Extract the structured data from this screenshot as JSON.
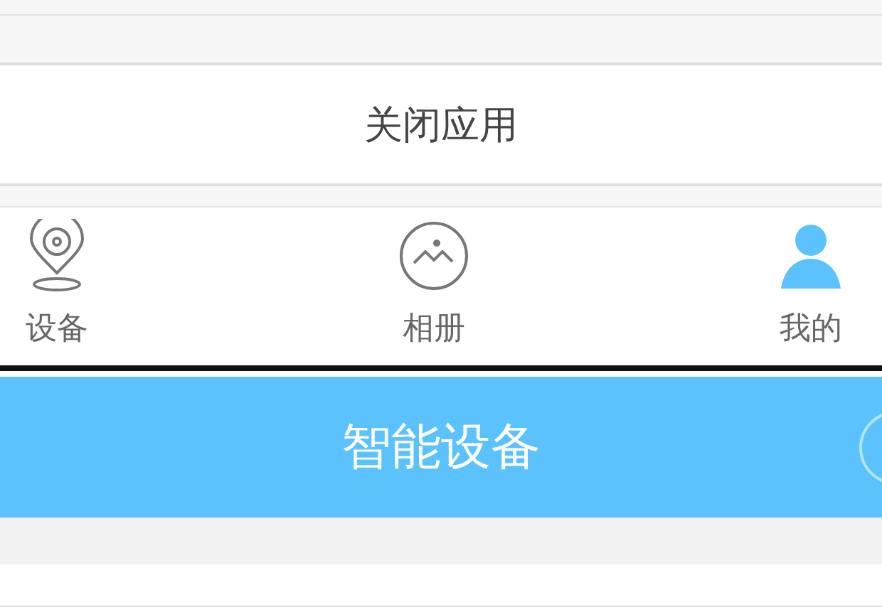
{
  "close_app_button": {
    "label": "关闭应用"
  },
  "tabs": [
    {
      "label": "设备",
      "kind": "device",
      "selected": false
    },
    {
      "label": "相册",
      "kind": "album",
      "selected": false
    },
    {
      "label": "我的",
      "kind": "profile",
      "selected": true
    }
  ],
  "header": {
    "title": "智能设备"
  }
}
